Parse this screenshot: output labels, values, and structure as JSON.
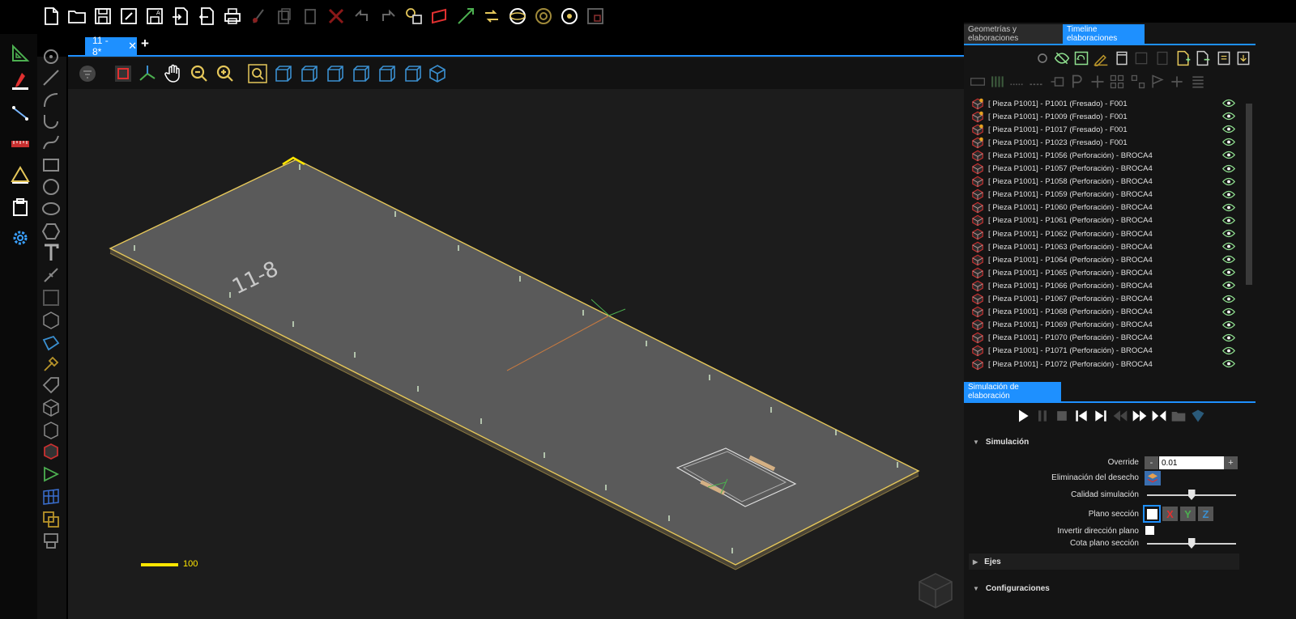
{
  "document_tab": {
    "label": "11 - 8*",
    "close": "✕",
    "add": "+"
  },
  "viewport": {
    "scale_label": "100",
    "part_text": "11-8"
  },
  "right_panel": {
    "tabs": [
      "Geometrías y elaboraciones",
      "Timeline elaboraciones"
    ],
    "active_tab": "Timeline elaboraciones",
    "timeline_items": [
      "[ Pieza P1001] - P1001 (Fresado) - F001",
      "[ Pieza P1001] - P1009 (Fresado) - F001",
      "[ Pieza P1001] - P1017 (Fresado) - F001",
      "[ Pieza P1001] - P1023 (Fresado) - F001",
      "[ Pieza P1001] - P1056 (Perforación) - BROCA4",
      "[ Pieza P1001] - P1057 (Perforación) - BROCA4",
      "[ Pieza P1001] - P1058 (Perforación) - BROCA4",
      "[ Pieza P1001] - P1059 (Perforación) - BROCA4",
      "[ Pieza P1001] - P1060 (Perforación) - BROCA4",
      "[ Pieza P1001] - P1061 (Perforación) - BROCA4",
      "[ Pieza P1001] - P1062 (Perforación) - BROCA4",
      "[ Pieza P1001] - P1063 (Perforación) - BROCA4",
      "[ Pieza P1001] - P1064 (Perforación) - BROCA4",
      "[ Pieza P1001] - P1065 (Perforación) - BROCA4",
      "[ Pieza P1001] - P1066 (Perforación) - BROCA4",
      "[ Pieza P1001] - P1067 (Perforación) - BROCA4",
      "[ Pieza P1001] - P1068 (Perforación) - BROCA4",
      "[ Pieza P1001] - P1069 (Perforación) - BROCA4",
      "[ Pieza P1001] - P1070 (Perforación) - BROCA4",
      "[ Pieza P1001] - P1071 (Perforación) - BROCA4",
      "[ Pieza P1001] - P1072 (Perforación) - BROCA4"
    ]
  },
  "simulation": {
    "header": "Simulación de elaboración",
    "section_simulacion": "Simulación",
    "override_label": "Override",
    "override_value": "0.01",
    "stepper_minus": "-",
    "stepper_plus": "+",
    "desecho_label": "Eliminación del desecho",
    "calidad_label": "Calidad simulación",
    "calidad_level": 0.5,
    "plano_label": "Plano sección",
    "axis_x": "X",
    "axis_y": "Y",
    "axis_z": "Z",
    "invertir_label": "Invertir dirección plano",
    "cota_label": "Cota plano sección",
    "cota_level": 0.5,
    "section_ejes": "Ejes",
    "section_config": "Configuraciones"
  },
  "colors": {
    "accent": "#1e90ff",
    "part_edge": "#e5c75a",
    "part_face": "#5a5a5a",
    "viewport_bg": "#1c1c1c",
    "eye": "#8fe08f"
  }
}
